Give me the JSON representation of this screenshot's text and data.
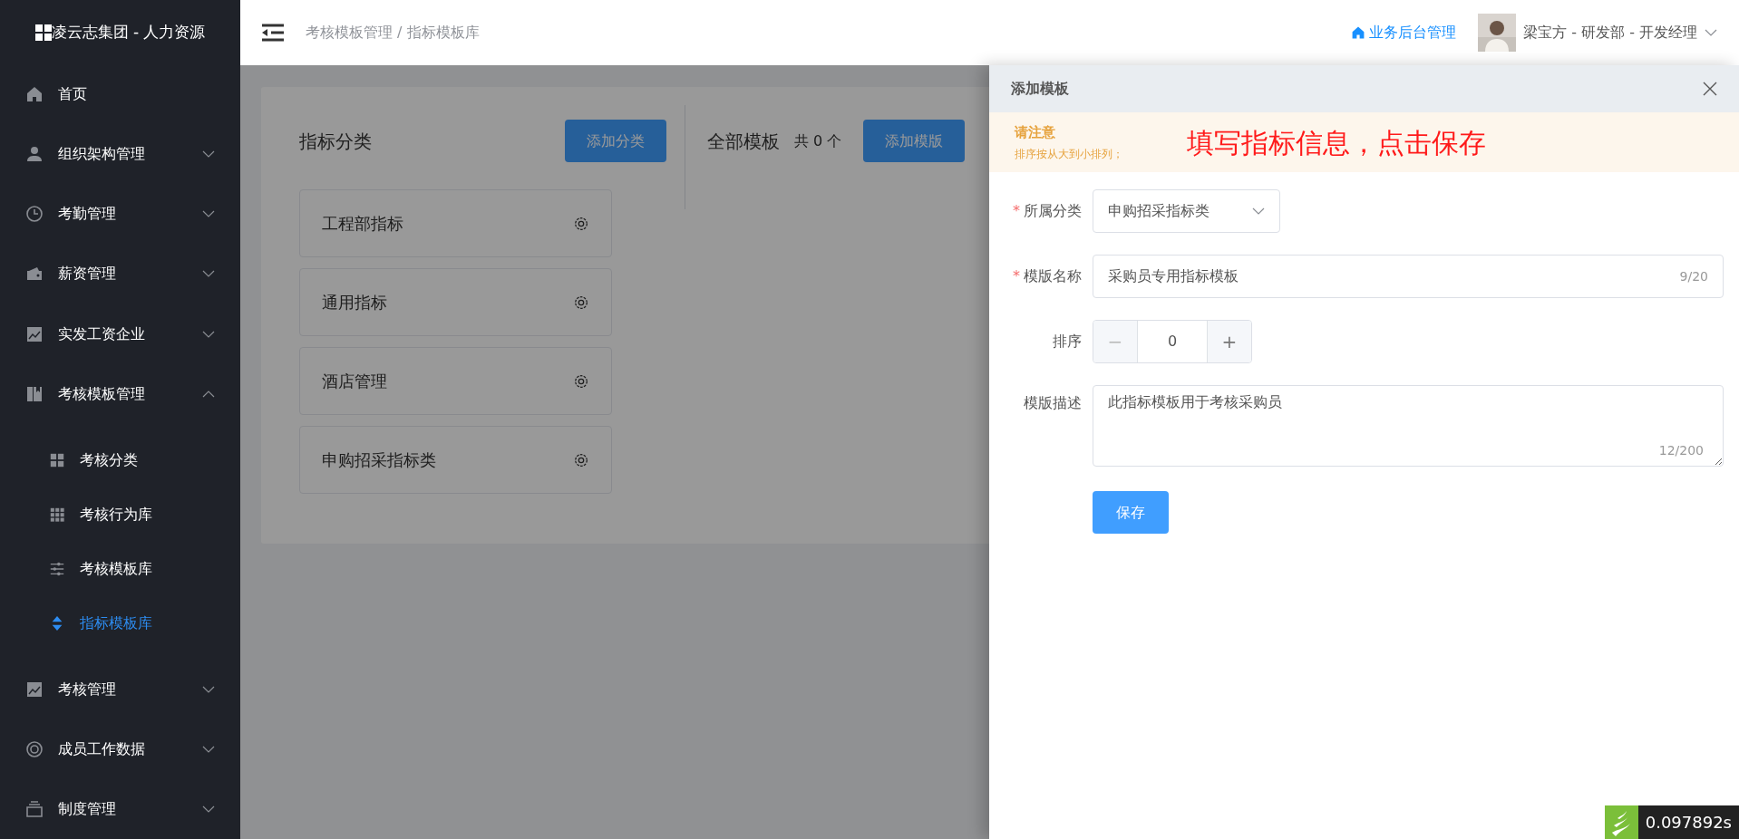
{
  "sidebar": {
    "brand": "凌云志集团 - 人力资源",
    "items": [
      {
        "label": "首页",
        "kind": "link"
      },
      {
        "label": "组织架构管理",
        "kind": "group",
        "expanded": false
      },
      {
        "label": "考勤管理",
        "kind": "group",
        "expanded": false
      },
      {
        "label": "薪资管理",
        "kind": "group",
        "expanded": false
      },
      {
        "label": "实发工资企业",
        "kind": "group",
        "expanded": false
      },
      {
        "label": "考核模板管理",
        "kind": "group",
        "expanded": true,
        "children": [
          {
            "label": "考核分类",
            "selected": false
          },
          {
            "label": "考核行为库",
            "selected": false
          },
          {
            "label": "考核模板库",
            "selected": false
          },
          {
            "label": "指标模板库",
            "selected": true
          }
        ]
      },
      {
        "label": "考核管理",
        "kind": "group",
        "expanded": false
      },
      {
        "label": "成员工作数据",
        "kind": "group",
        "expanded": false
      },
      {
        "label": "制度管理",
        "kind": "group",
        "expanded": false
      }
    ]
  },
  "header": {
    "breadcrumb": "考核模板管理 / 指标模板库",
    "home_link": "业务后台管理",
    "user": "梁宝方 - 研发部 - 开发经理"
  },
  "categories": {
    "title": "指标分类",
    "add_button": "添加分类",
    "items": [
      "工程部指标",
      "通用指标",
      "酒店管理",
      "申购招采指标类"
    ]
  },
  "templates": {
    "title": "全部模板",
    "count": "共 0 个",
    "add_button": "添加模版"
  },
  "drawer": {
    "title": "添加模板",
    "notice": {
      "title": "请注意",
      "text": "排序按从大到小排列；",
      "annotation": "填写指标信息，点击保存"
    },
    "fields": [
      {
        "kind": "select",
        "label": "所属分类",
        "required": true,
        "value": "申购招采指标类"
      },
      {
        "kind": "text",
        "label": "模版名称",
        "required": true,
        "value": "采购员专用指标模板",
        "counter": "9/20"
      },
      {
        "kind": "number",
        "label": "排序",
        "required": false,
        "value": "0",
        "minus": "−",
        "plus": "+"
      },
      {
        "kind": "textarea",
        "label": "模版描述",
        "required": false,
        "value": "此指标模板用于考核采购员",
        "counter": "12/200"
      }
    ],
    "save_button": "保存",
    "required_mark": "*"
  },
  "timer": "0.097892s"
}
